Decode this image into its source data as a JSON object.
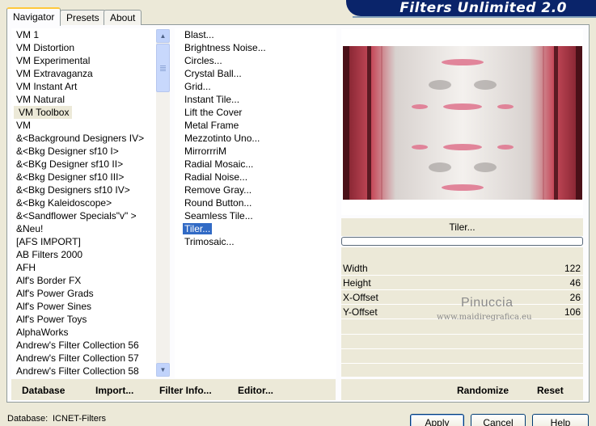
{
  "title_banner": "Filters Unlimited 2.0",
  "tabs": [
    {
      "label": "Navigator",
      "active": true
    },
    {
      "label": "Presets",
      "active": false
    },
    {
      "label": "About",
      "active": false
    }
  ],
  "categories": [
    "VM 1",
    "VM Distortion",
    "VM Experimental",
    "VM Extravaganza",
    "VM Instant Art",
    "VM Natural",
    "VM Toolbox",
    "VM",
    "&<Background Designers IV>",
    "&<Bkg Designer sf10 I>",
    "&<BKg Designer sf10 II>",
    "&<Bkg Designer sf10 III>",
    "&<Bkg Designers sf10 IV>",
    "&<Bkg Kaleidoscope>",
    "&<Sandflower Specials\"v\" >",
    "&Neu!",
    "[AFS IMPORT]",
    "AB Filters 2000",
    "AFH",
    "Alf's Border FX",
    "Alf's Power Grads",
    "Alf's Power Sines",
    "Alf's Power Toys",
    "AlphaWorks",
    "Andrew's Filter Collection 56",
    "Andrew's Filter Collection 57",
    "Andrew's Filter Collection 58"
  ],
  "selected_category": "VM Toolbox",
  "filters": [
    "Blast...",
    "Brightness Noise...",
    "Circles...",
    "Crystal Ball...",
    "Grid...",
    "Instant Tile...",
    "Lift the Cover",
    "Metal Frame",
    "Mezzotinto Uno...",
    "MirrorrriM",
    "Radial Mosaic...",
    "Radial Noise...",
    "Remove Gray...",
    "Round Button...",
    "Seamless Tile...",
    "Tiler...",
    "Trimosaic..."
  ],
  "selected_filter": "Tiler...",
  "current_filter_name": "Tiler...",
  "params": [
    {
      "label": "Width",
      "value": "122"
    },
    {
      "label": "Height",
      "value": "46"
    },
    {
      "label": "X-Offset",
      "value": "26"
    },
    {
      "label": "Y-Offset",
      "value": "106"
    }
  ],
  "watermark": {
    "name": "Pinuccia",
    "url": "www.maidiregrafica.eu"
  },
  "left_buttons": {
    "database": "Database",
    "import": "Import...",
    "filter_info": "Filter Info...",
    "editor": "Editor..."
  },
  "right_buttons": {
    "randomize": "Randomize",
    "reset": "Reset"
  },
  "status": {
    "label": "Database:",
    "value": "ICNET-Filters"
  },
  "dialog_buttons": {
    "apply": "Apply",
    "cancel": "Cancel",
    "help": "Help"
  },
  "colors": {
    "selection": "#316ac5",
    "banner": "#0a246a",
    "face": "#ece9d8"
  }
}
